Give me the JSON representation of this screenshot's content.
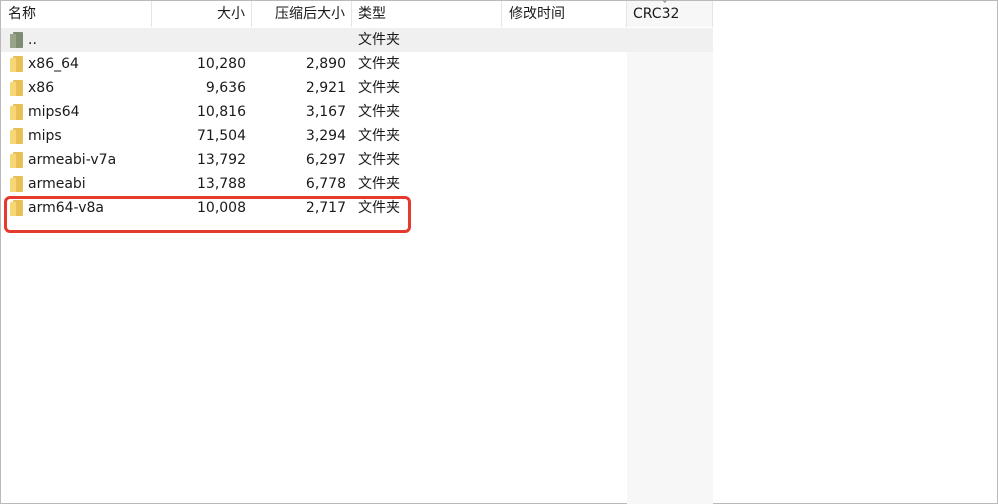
{
  "columns": {
    "name": "名称",
    "size": "大小",
    "packed_size": "压缩后大小",
    "type": "类型",
    "modified": "修改时间",
    "crc": "CRC32"
  },
  "sort_indicator": "ˇ",
  "files": [
    {
      "name": "..",
      "size": "",
      "packed_size": "",
      "type": "文件夹",
      "icon": "folder-up-icon"
    },
    {
      "name": "x86_64",
      "size": "10,280",
      "packed_size": "2,890",
      "type": "文件夹",
      "icon": "folder-icon"
    },
    {
      "name": "x86",
      "size": "9,636",
      "packed_size": "2,921",
      "type": "文件夹",
      "icon": "folder-icon"
    },
    {
      "name": "mips64",
      "size": "10,816",
      "packed_size": "3,167",
      "type": "文件夹",
      "icon": "folder-icon"
    },
    {
      "name": "mips",
      "size": "71,504",
      "packed_size": "3,294",
      "type": "文件夹",
      "icon": "folder-icon"
    },
    {
      "name": "armeabi-v7a",
      "size": "13,792",
      "packed_size": "6,297",
      "type": "文件夹",
      "icon": "folder-icon"
    },
    {
      "name": "armeabi",
      "size": "13,788",
      "packed_size": "6,778",
      "type": "文件夹",
      "icon": "folder-icon"
    },
    {
      "name": "arm64-v8a",
      "size": "10,008",
      "packed_size": "2,717",
      "type": "文件夹",
      "icon": "folder-icon"
    }
  ],
  "colors": {
    "highlight": "#e53b2f",
    "folder": "#f7d774",
    "selected_row": "#f0f0f0"
  }
}
